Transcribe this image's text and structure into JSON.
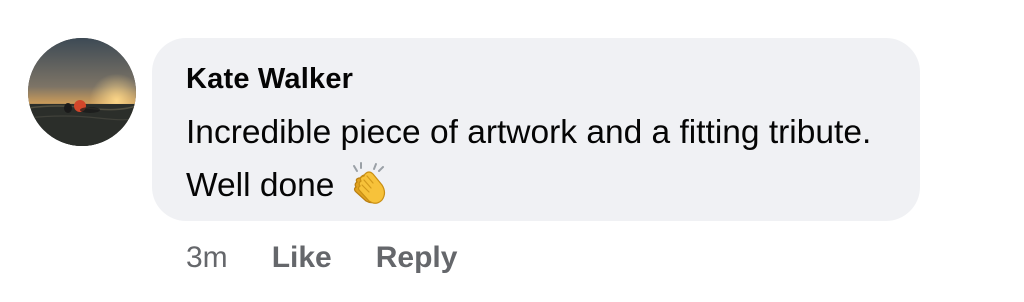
{
  "comment": {
    "author": "Kate Walker",
    "text": "Incredible piece of artwork and a fitting tribute. Well done",
    "emoji_icon": "clapping-hands-icon"
  },
  "actions": {
    "timestamp": "3m",
    "like_label": "Like",
    "reply_label": "Reply"
  },
  "colors": {
    "bubble_background": "#f0f1f4",
    "primary_text": "#050505",
    "secondary_text": "#65676b"
  }
}
